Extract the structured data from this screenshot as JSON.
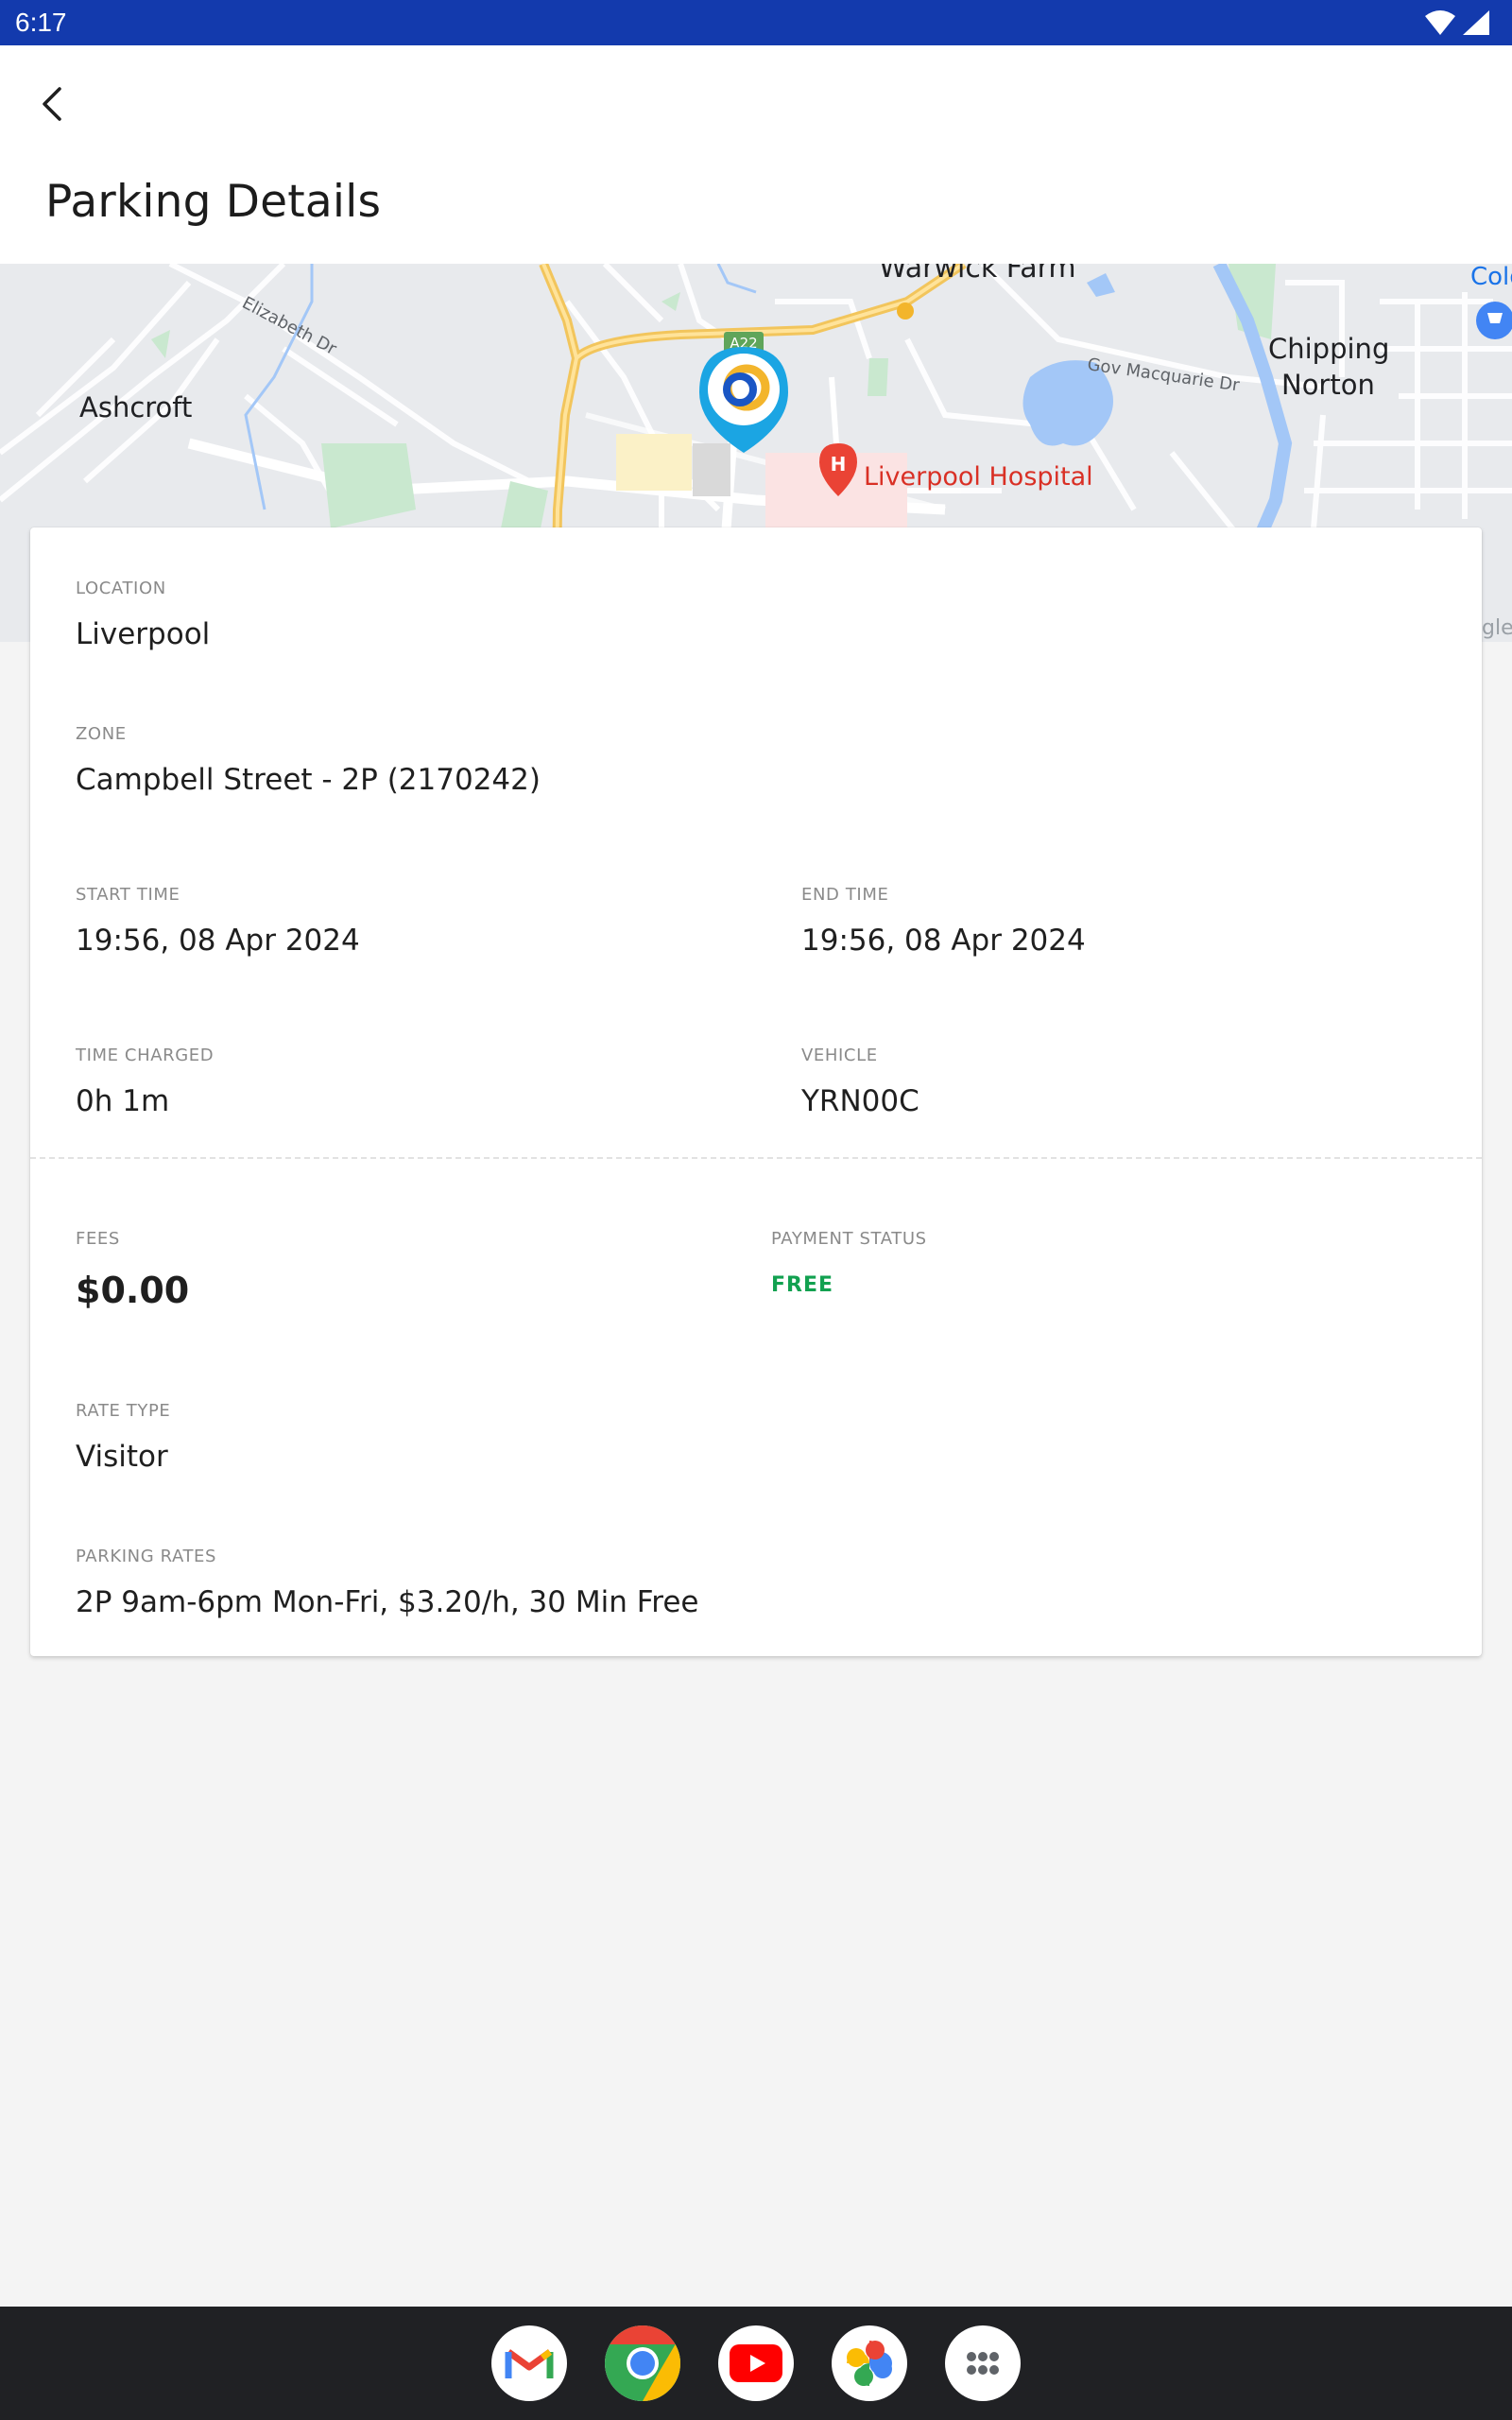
{
  "status_bar": {
    "time": "6:17",
    "icons": [
      "wifi-icon",
      "signal-icon"
    ]
  },
  "app_bar": {
    "back_icon": "back-arrow-icon",
    "title": "Parking Details"
  },
  "map": {
    "labels": {
      "warwick_farm": "Warwick Farm",
      "ashcroft": "Ashcroft",
      "chipping": "Chipping",
      "norton": "Norton",
      "elizabeth_dr": "Elizabeth Dr",
      "gov_macquarie_dr": "Gov Macquarie Dr",
      "liverpool_hospital": "Liverpool Hospital",
      "road_sign": "A22",
      "corner_text": "Colo",
      "google": "gle"
    },
    "marker_icon": "parking-location-pin-icon",
    "hospital_icon": "hospital-icon",
    "shopping_icon": "shopping-cart-icon"
  },
  "details": {
    "location": {
      "label": "LOCATION",
      "value": "Liverpool"
    },
    "zone": {
      "label": "ZONE",
      "value": "Campbell Street - 2P (2170242)"
    },
    "start_time": {
      "label": "START TIME",
      "value": "19:56, 08 Apr 2024"
    },
    "end_time": {
      "label": "END TIME",
      "value": "19:56, 08 Apr 2024"
    },
    "time_charged": {
      "label": "TIME CHARGED",
      "value": "0h 1m"
    },
    "vehicle": {
      "label": "VEHICLE",
      "value": "YRN00C"
    },
    "fees": {
      "label": "FEES",
      "value": "$0.00"
    },
    "payment_status": {
      "label": "PAYMENT STATUS",
      "value": "FREE"
    },
    "rate_type": {
      "label": "RATE TYPE",
      "value": "Visitor"
    },
    "parking_rates": {
      "label": "PARKING RATES",
      "value": "2P 9am-6pm Mon-Fri, $3.20/h, 30 Min Free"
    }
  },
  "colors": {
    "status_bar": "#133aad",
    "accent_free": "#12a150",
    "marker": "#1ba5e3",
    "nav_bar": "#202124"
  },
  "dock": {
    "apps": [
      "gmail-icon",
      "chrome-icon",
      "youtube-icon",
      "photos-icon",
      "app-drawer-icon"
    ]
  }
}
